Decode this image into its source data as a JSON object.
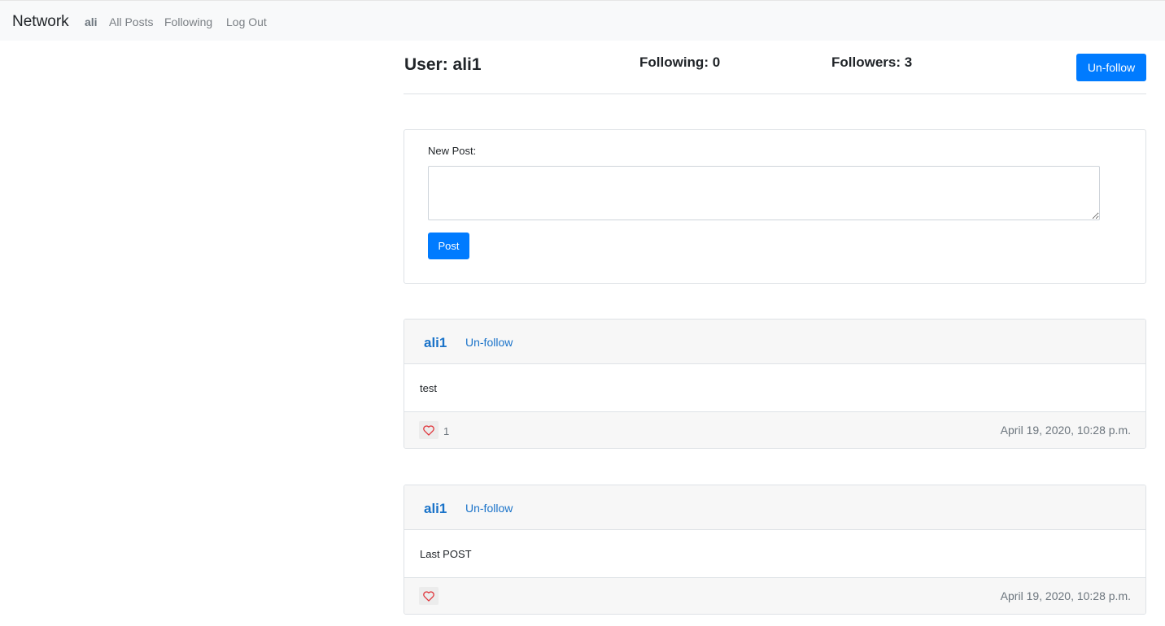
{
  "navbar": {
    "brand": "Network",
    "user": "ali",
    "all_posts": "All Posts",
    "following": "Following",
    "logout": "Log Out"
  },
  "profile": {
    "title": "User: ali1",
    "following": "Following: 0",
    "followers": "Followers: 3",
    "unfollow_label": "Un-follow"
  },
  "new_post": {
    "label": "New Post:",
    "value": "",
    "submit_label": "Post"
  },
  "posts": [
    {
      "author": "ali1",
      "unfollow_label": "Un-follow",
      "body": "test",
      "likes": "1",
      "timestamp": "April 19, 2020, 10:28 p.m."
    },
    {
      "author": "ali1",
      "unfollow_label": "Un-follow",
      "body": "Last POST",
      "likes": "",
      "timestamp": "April 19, 2020, 10:28 p.m."
    }
  ],
  "colors": {
    "accent": "#007bff",
    "link": "#1a73c9",
    "heart": "#e0343a"
  },
  "icons": {
    "like": "heart-outline-icon"
  }
}
